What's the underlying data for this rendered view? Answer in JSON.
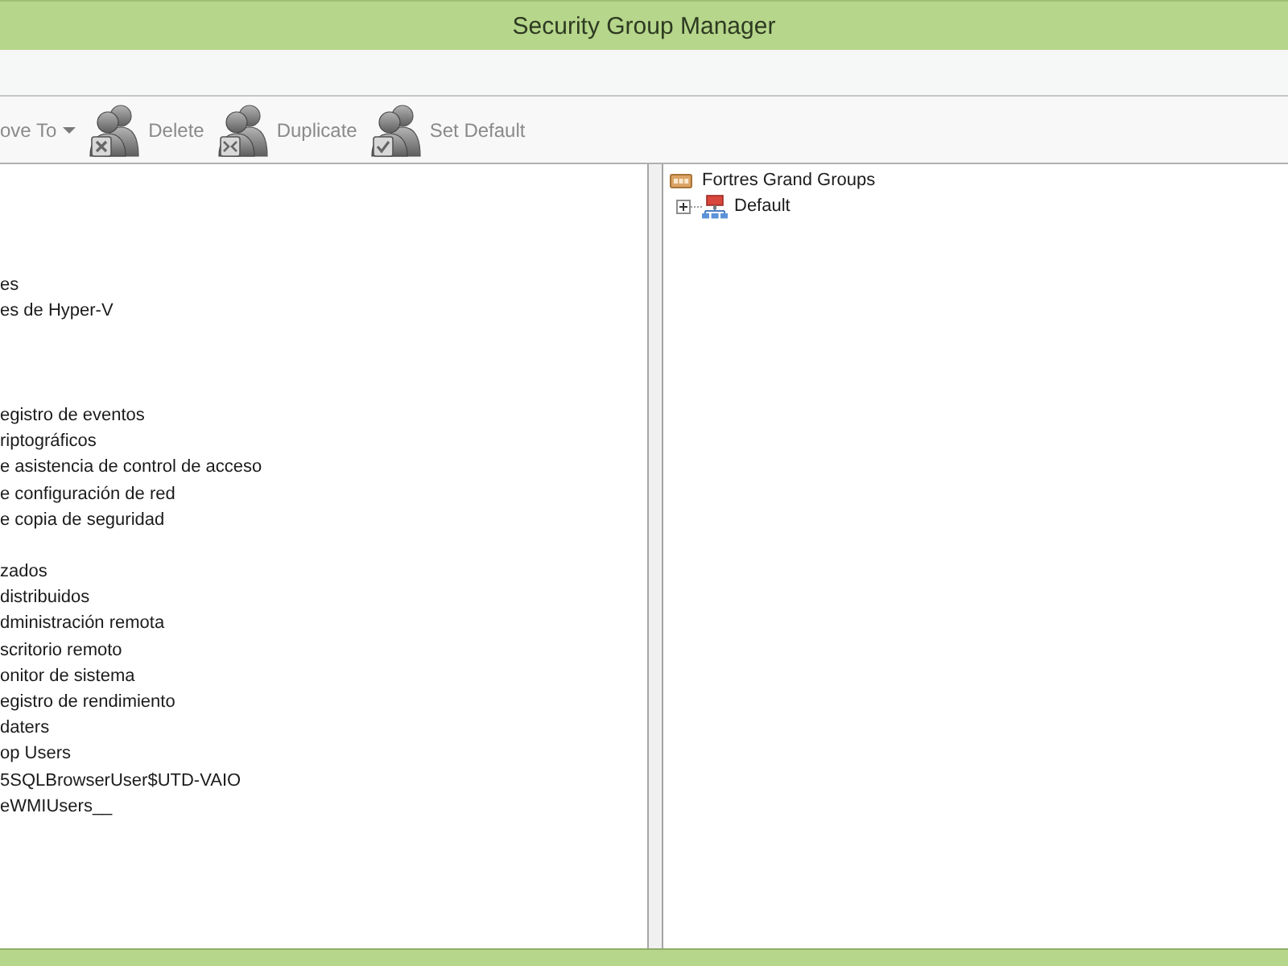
{
  "window": {
    "title": "Security Group Manager"
  },
  "toolbar": {
    "items": [
      {
        "kind": "dropdown",
        "label": "ove To",
        "disabled": true
      },
      {
        "kind": "delete",
        "label": "Delete",
        "disabled": true
      },
      {
        "kind": "duplicate",
        "label": "Duplicate",
        "disabled": true
      },
      {
        "kind": "default",
        "label": "Set Default",
        "disabled": true
      }
    ]
  },
  "group_list": {
    "groups": [
      [
        "es",
        "es de Hyper-V"
      ],
      [
        "egistro de eventos",
        "riptográficos",
        "e asistencia de control de acceso",
        "e configuración de red",
        "e copia de seguridad"
      ],
      [
        "zados",
        "distribuidos",
        "dministración remota",
        "scritorio remoto",
        "onitor de sistema",
        "egistro de rendimiento",
        "daters",
        "op Users",
        "5SQLBrowserUser$UTD-VAIO",
        "eWMIUsers__"
      ]
    ]
  },
  "group_tree": {
    "nodes": [
      {
        "label": "Fortres Grand Groups",
        "children": [
          {
            "label": "Default",
            "expanded": false
          }
        ]
      }
    ]
  }
}
